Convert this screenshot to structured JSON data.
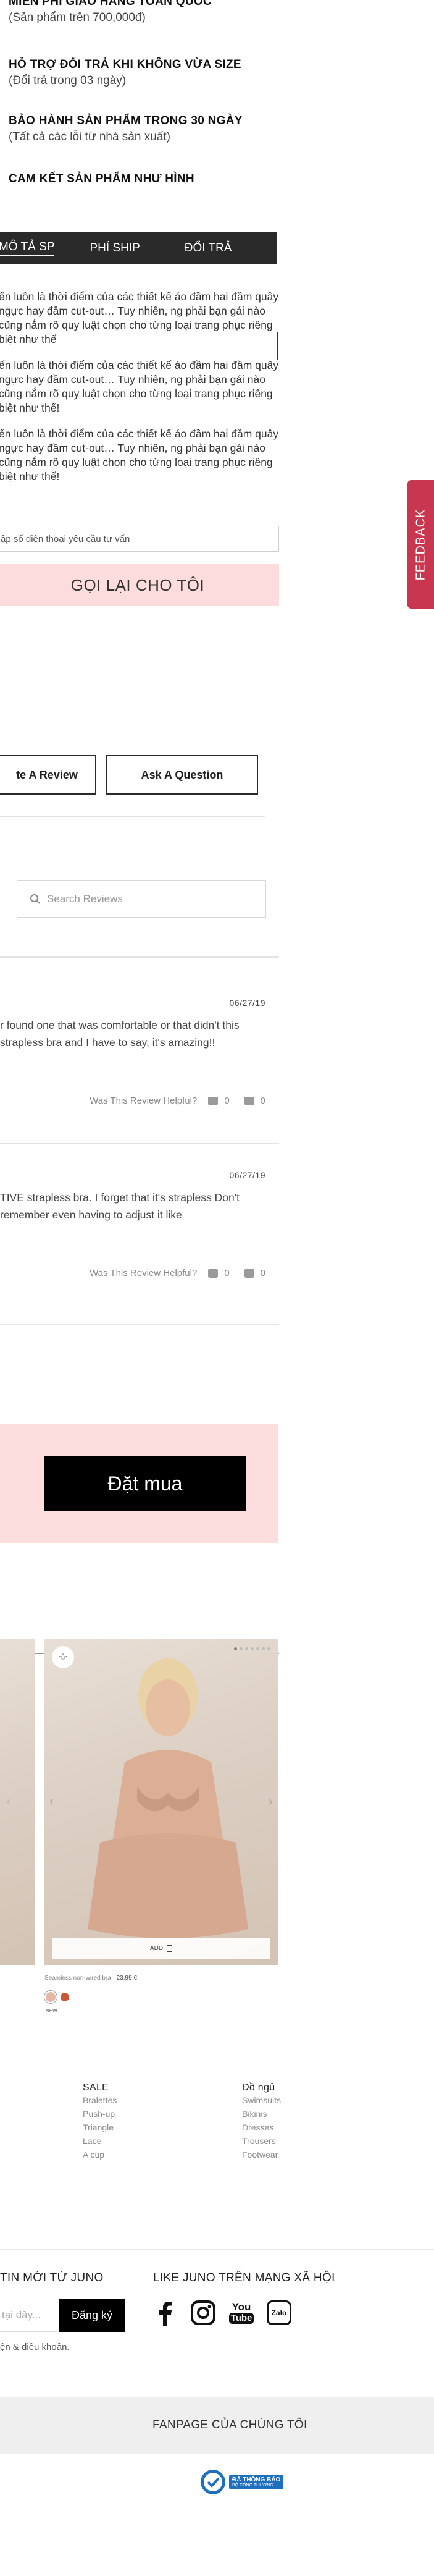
{
  "policies": [
    {
      "title": "MIỄN PHÍ GIAO HÀNG TOÀN QUỐC",
      "sub": "(Sản phẩm trên 700,000đ)"
    },
    {
      "title": "HỖ TRỢ ĐỔI TRẢ KHI KHÔNG VỪA SIZE",
      "sub": "(Đổi trả trong 03 ngày)"
    },
    {
      "title": "BẢO HÀNH SẢN PHẨM TRONG 30 NGÀY",
      "sub": "(Tất cả các lỗi từ nhà sản xuất)"
    },
    {
      "title": "CAM KẾT SẢN PHẨM NHƯ HÌNH",
      "sub": ""
    }
  ],
  "tabs": [
    "MÔ TẢ SP",
    "PHÍ SHIP",
    "ĐỔI TRẢ"
  ],
  "description": [
    "ến luôn là thời điểm của các thiết kế áo đầm hai đầm quây ngực hay đầm cut-out… Tuy nhiên, ng phải bạn gái nào cũng nắm rõ quy luật chọn cho từng loại trang phục riêng biệt như thế",
    "ến luôn là thời điểm của các thiết kế áo đầm hai đầm quây ngực hay đầm cut-out… Tuy nhiên, ng phải bạn gái nào cũng nắm rõ quy luật chọn cho từng loại trang phục riêng biệt như thế!",
    "ến luôn là thời điểm của các thiết kế áo đầm hai đầm quây ngực hay đầm cut-out… Tuy nhiên, ng phải bạn gái nào cũng nắm rõ quy luật chọn cho từng loại trang phục riêng biệt như thế!"
  ],
  "feedback_label": "FEEDBACK",
  "phone_placeholder": "ập số điện thoại yêu cầu tư vấn",
  "call_button": "GỌI LẠI CHO TÔI",
  "reviews": {
    "write_button": "te A Review",
    "ask_button": "Ask A Question",
    "search_placeholder": "Search Reviews",
    "helpful_label": "Was This Review Helpful?",
    "items": [
      {
        "date": "06/27/19",
        "text": "r found one that was comfortable or that didn't this strapless bra and I have to say, it's amazing!!",
        "up": "0",
        "down": "0"
      },
      {
        "date": "06/27/19",
        "text": "TIVE strapless bra. I forget that it's strapless Don't remember even having to adjust it like",
        "up": "0",
        "down": "0"
      }
    ]
  },
  "order_button": "Đặt mua",
  "product": {
    "add_label": "ADD",
    "name": "Seamless non-wired bra",
    "price": "23,99 €",
    "badge": "NEW"
  },
  "footer_columns": [
    {
      "title": "SALE",
      "links": [
        "Bralettes",
        "Push-up",
        "Triangle",
        "Lace",
        "A cup"
      ]
    },
    {
      "title": "Đồ ngủ",
      "links": [
        "Swimsuits",
        "Bikinis",
        "Dresses",
        "Trousers",
        "Footwear"
      ]
    }
  ],
  "newsletter": {
    "title": "TIN MỚI TỪ JUNO",
    "placeholder": "tại đây...",
    "button": "Đăng ký",
    "terms": "ện & điều khoản."
  },
  "social": {
    "title": "LIKE JUNO TRÊN MẠNG XÃ HỘI",
    "youtube_text_1": "You",
    "youtube_text_2": "Tube",
    "zalo_text": "Zalo"
  },
  "fanpage": "FANPAGE CỦA CHÚNG TÔI",
  "certification": {
    "line1": "ĐÃ THÔNG BÁO",
    "line2": "BỘ CÔNG THƯƠNG"
  },
  "colors": {
    "pink": "#fcdcdc",
    "feedback": "#c8374f",
    "dark": "#2a2a2a",
    "gov_blue": "#1f6fbf"
  }
}
